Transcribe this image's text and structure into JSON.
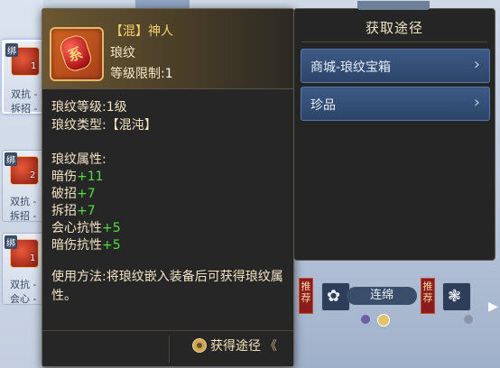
{
  "inventory": {
    "slots": [
      {
        "bind": "绑",
        "count": "1",
        "line1": "双抗 -",
        "line2": "拆招 -",
        "selected": true
      },
      {
        "bind": "绑",
        "count": "2",
        "line1": "双抗 -",
        "line2": "拆招 -",
        "selected": false
      },
      {
        "bind": "绑",
        "count": "1",
        "line1": "双抗 -",
        "line2": "会心 -",
        "selected": false
      }
    ]
  },
  "tooltip": {
    "title": "【混】神人",
    "subtitle": "琅纹",
    "level_req_label": "等级限制:",
    "level_req_value": "1",
    "icon_glyph": "系",
    "level_line": "琅纹等级:1级",
    "type_line": "琅纹类型:【混沌】",
    "attr_header": "琅纹属性:",
    "attributes": [
      {
        "name": "暗伤",
        "value": "+11"
      },
      {
        "name": "破招",
        "value": "+7"
      },
      {
        "name": "拆招",
        "value": "+7"
      },
      {
        "name": "会心抗性",
        "value": "+5"
      },
      {
        "name": "暗伤抗性",
        "value": "+5"
      }
    ],
    "usage": "使用方法:将琅纹嵌入装备后可获得琅纹属性。",
    "get_route_label": "获得途径",
    "get_route_chevron": "《"
  },
  "acquisition": {
    "title": "获取途径",
    "options": [
      {
        "label": "商城-琅纹宝箱",
        "chevron": "›"
      },
      {
        "label": "珍品",
        "chevron": "›"
      }
    ]
  },
  "recommend": {
    "badge": "推荐",
    "skill_label": "连绵",
    "arrow": "▶"
  },
  "colors": {
    "attr_green": "#4fe040",
    "title_gold": "#f4d16a",
    "acq_button": "#3d5a86"
  }
}
